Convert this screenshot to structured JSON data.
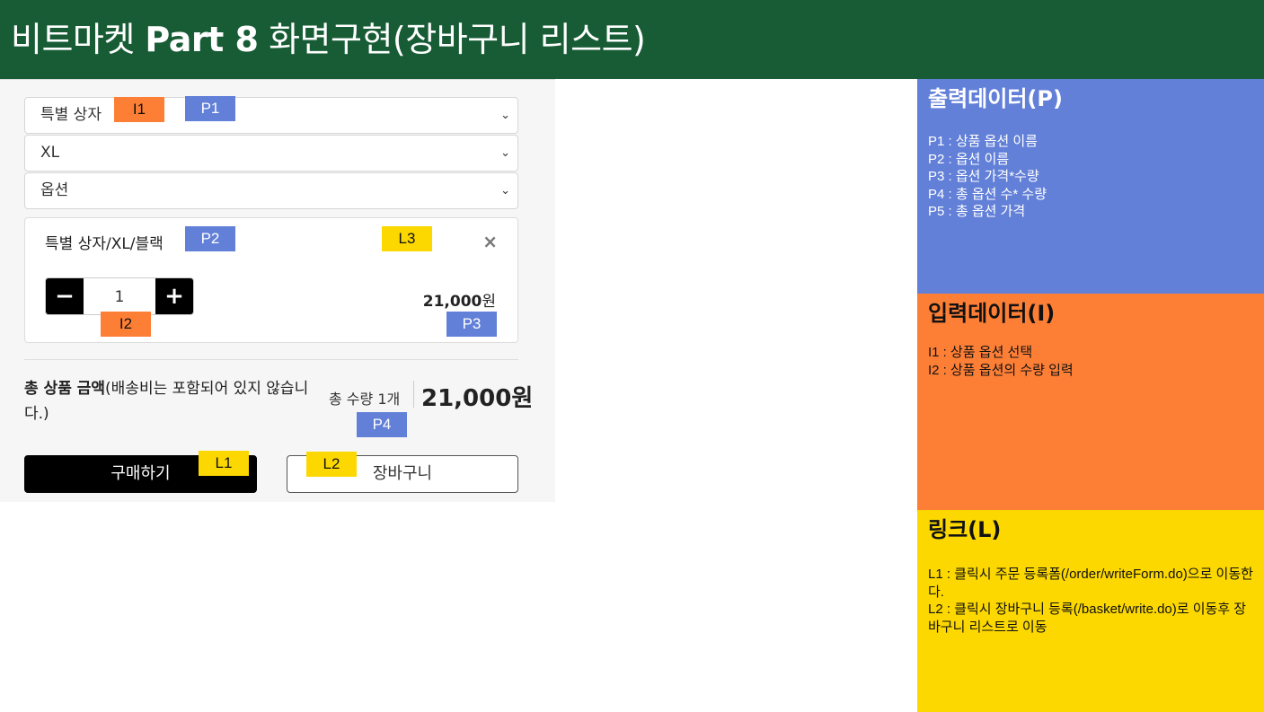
{
  "header": {
    "title_prefix": "비트마켓 ",
    "title_bold": "Part 8",
    "title_suffix": " 화면구현(장바구니 리스트)"
  },
  "selects": [
    {
      "value": "특별 상자"
    },
    {
      "value": "XL"
    },
    {
      "value": "옵션"
    }
  ],
  "option": {
    "name": "특별 상자/XL/블랙",
    "close": "×",
    "minus": "−",
    "plus": "+",
    "quantity": "1",
    "price": "21,000",
    "currency": "원"
  },
  "total": {
    "label_bold": "총 상품 금액",
    "label_rest": "(배송비는 포함되어 있지 않습니다.)",
    "quantity_text": "총 수량 1개",
    "price": "21,000원"
  },
  "buttons": {
    "buy": "구매하기",
    "cart": "장바구니"
  },
  "tags": {
    "I1": "I1",
    "I2": "I2",
    "P1": "P1",
    "P2": "P2",
    "P3": "P3",
    "P4": "P4",
    "L1": "L1",
    "L2": "L2",
    "L3": "L3"
  },
  "legend": {
    "output": {
      "title": "출력데이터(P)",
      "items": [
        "P1 : 상품 옵션 이름",
        "P2 : 옵션 이름",
        "P3 : 옵션 가격*수량",
        "P4 : 총 옵션 수* 수량",
        "P5 : 총 옵션 가격"
      ]
    },
    "input": {
      "title": "입력데이터(I)",
      "items": [
        "I1 : 상품 옵션 선택",
        "I2 : 상품 옵션의 수량 입력"
      ]
    },
    "link": {
      "title": "링크(L)",
      "items": [
        "L1 : 클릭시 주문 등록폼(/order/writeForm.do)으로 이동한다.",
        "L2 : 클릭시 장바구니 등록(/basket/write.do)로 이동후 장바구니 리스트로 이동"
      ]
    }
  },
  "colors": {
    "header": "#175c35",
    "output": "#6380d8",
    "input": "#fd7f36",
    "link": "#fcd800"
  }
}
